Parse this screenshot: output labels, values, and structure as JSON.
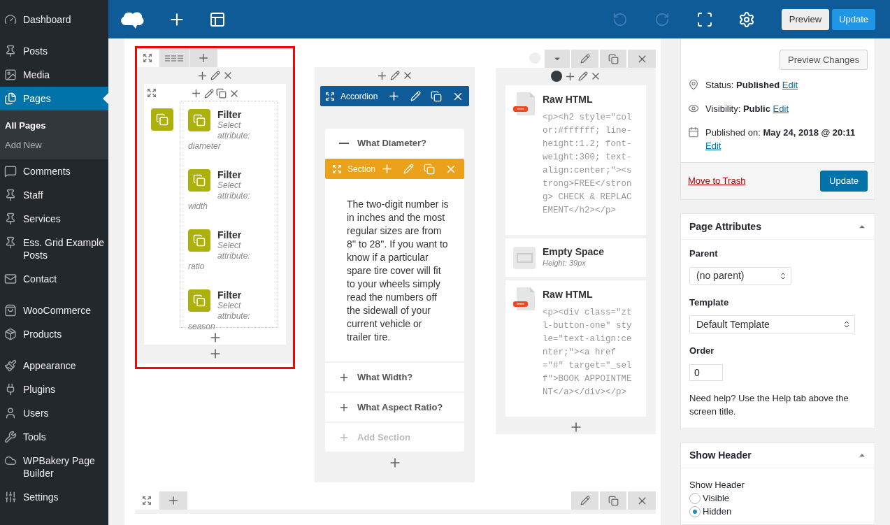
{
  "topbar": {
    "undo": {
      "disabled": true
    },
    "redo": {
      "disabled": true
    },
    "preview": "Preview",
    "update": "Update"
  },
  "sidebar": {
    "groups": [
      [
        {
          "label": "Dashboard",
          "selected": false
        }
      ],
      [
        {
          "label": "Posts",
          "selected": false
        },
        {
          "label": "Media",
          "selected": false
        },
        {
          "label": "Pages",
          "selected": true,
          "submenu": [
            {
              "label": "All Pages",
              "selected": true
            },
            {
              "label": "Add New",
              "selected": false
            }
          ]
        },
        {
          "label": "Comments",
          "selected": false
        },
        {
          "label": "Staff",
          "selected": false
        },
        {
          "label": "Services",
          "selected": false
        },
        {
          "label": "Ess. Grid Example Posts",
          "selected": false
        },
        {
          "label": "Contact",
          "selected": false
        }
      ],
      [
        {
          "label": "WooCommerce",
          "selected": false
        },
        {
          "label": "Products",
          "selected": false
        }
      ],
      [
        {
          "label": "Appearance",
          "selected": false
        },
        {
          "label": "Plugins",
          "selected": false
        },
        {
          "label": "Users",
          "selected": false
        },
        {
          "label": "Tools",
          "selected": false
        },
        {
          "label": "WPBakery Page Builder",
          "selected": false
        },
        {
          "label": "Settings",
          "selected": false
        }
      ]
    ]
  },
  "builder": {
    "filter_column": {
      "highlighted": true,
      "filters": [
        {
          "title": "Filter",
          "description": "Select attribute: diameter"
        },
        {
          "title": "Filter",
          "description": "Select attribute: width"
        },
        {
          "title": "Filter",
          "description": "Select attribute: ratio"
        },
        {
          "title": "Filter",
          "description": "Select attribute: season"
        }
      ]
    },
    "accordion": {
      "title": "Accordion",
      "sections": [
        {
          "title": "What Diameter?",
          "expanded": true,
          "section_label": "Section",
          "body": "The two-digit number is in inches and the most regular sizes are from 8'' to 28''. If you want to know if a particular spare tire cover will fit to your wheels simply read the numbers off the sidewall of your current vehicle or trailer tire."
        },
        {
          "title": "What Width?",
          "expanded": false
        },
        {
          "title": "What Aspect Ratio?",
          "expanded": false
        }
      ],
      "add_section": "Add Section"
    },
    "html_column": {
      "elements": [
        {
          "kind": "raw_html",
          "title": "Raw HTML",
          "code": "<p><h2 style=\"color:#ffffff; line-height:1.2; font-weight:300; text-align:center;\"><strong>FREE</strong> CHECK & REPLACEMENT</h2></p>"
        },
        {
          "kind": "empty_space",
          "title": "Empty Space",
          "detail": "Height: 39px"
        },
        {
          "kind": "raw_html",
          "title": "Raw HTML",
          "code": "<p><div class=\"ztl-button-one\" style=\"text-align:center;\"><a href=\"#\" target=\"_self\">BOOK APPOINTMENT</a></div></p>"
        }
      ]
    }
  },
  "publish": {
    "preview_changes": "Preview Changes",
    "lines": [
      {
        "text": "Status: **Published**",
        "edit": "Edit"
      },
      {
        "text": "Visibility: **Public**",
        "edit": "Edit"
      },
      {
        "text": "Published on: **May 24, 2018 @ 20:11**",
        "edit": "Edit"
      }
    ],
    "trash": "Move to Trash",
    "update": "Update"
  },
  "page_attributes": {
    "title": "Page Attributes",
    "parent_label": "Parent",
    "parent_value": "(no parent)",
    "template_label": "Template",
    "template_value": "Default Template",
    "order_label": "Order",
    "order_value": "0",
    "help": "Need help? Use the Help tab above the screen title."
  },
  "show_header": {
    "title": "Show Header",
    "label": "Show Header",
    "options": [
      {
        "label": "Visible",
        "selected": false
      },
      {
        "label": "Hidden",
        "selected": true
      }
    ]
  }
}
